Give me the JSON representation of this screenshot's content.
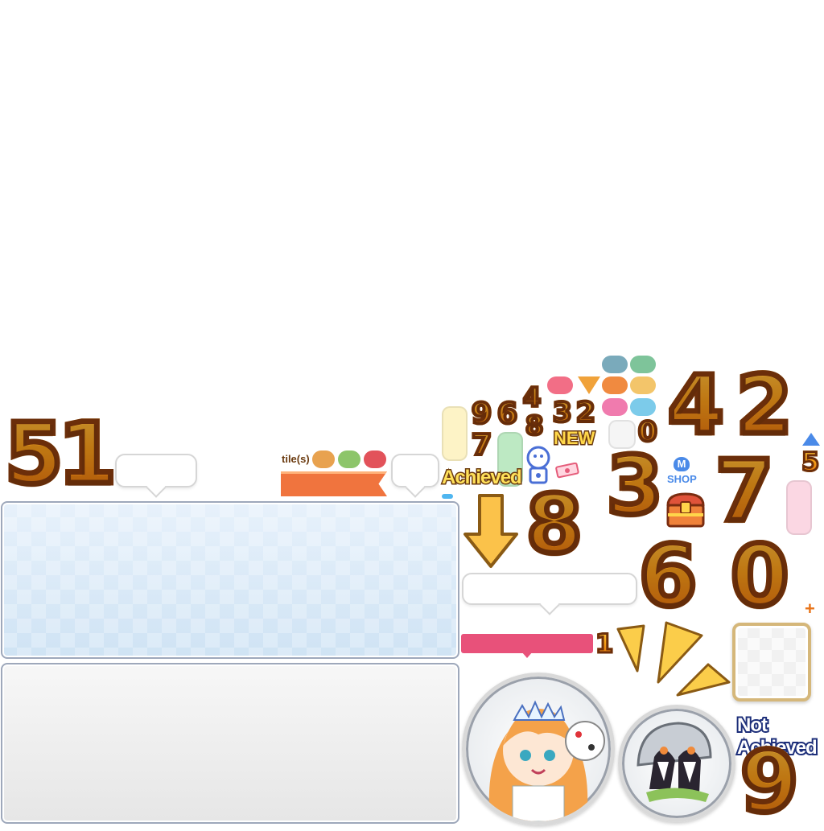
{
  "labels": {
    "tiles": "tile(s)",
    "achieved": "Achieved",
    "new": "NEW",
    "shop": "SHOP",
    "shop_m": "M",
    "not_achieved": "Not Achieved",
    "plus": "+"
  },
  "digits": {
    "d51": "51",
    "d9a": "9",
    "d6a": "6",
    "d4a": "4",
    "d8a": "8",
    "d3a": "3",
    "d2a": "2",
    "d7a": "7",
    "d0a": "0",
    "d4b": "4",
    "d2b": "2",
    "d5": "5",
    "d3b": "3",
    "d7b": "7",
    "d8b": "8",
    "d6b": "6",
    "d0b": "0",
    "d1": "1",
    "d9b": "9"
  },
  "colors": {
    "orange_pill": "#e8a24f",
    "green_pill": "#8dc56a",
    "red_pill": "#e2525a",
    "pink_pill": "#f26e86",
    "teal_pill": "#7aaabb",
    "mint_pill": "#7ec49a",
    "amber_pill": "#f08a40",
    "sand_pill": "#f3c56a",
    "rose_pill": "#f07bae",
    "sky_pill": "#7ccbea",
    "ribbon_orange": "#f0743e",
    "ribbon_pink": "#e8517a"
  }
}
